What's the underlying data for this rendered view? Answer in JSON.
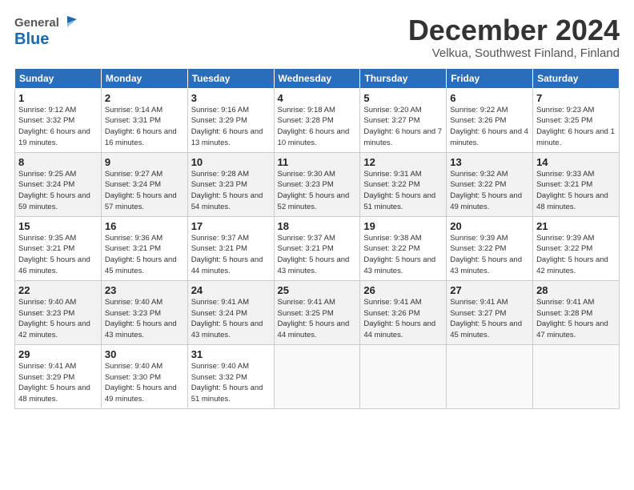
{
  "header": {
    "logo_general": "General",
    "logo_blue": "Blue",
    "month_title": "December 2024",
    "location": "Velkua, Southwest Finland, Finland"
  },
  "weekdays": [
    "Sunday",
    "Monday",
    "Tuesday",
    "Wednesday",
    "Thursday",
    "Friday",
    "Saturday"
  ],
  "weeks": [
    [
      {
        "day": 1,
        "sunrise": "9:12 AM",
        "sunset": "3:32 PM",
        "daylight": "6 hours and 19 minutes."
      },
      {
        "day": 2,
        "sunrise": "9:14 AM",
        "sunset": "3:31 PM",
        "daylight": "6 hours and 16 minutes."
      },
      {
        "day": 3,
        "sunrise": "9:16 AM",
        "sunset": "3:29 PM",
        "daylight": "6 hours and 13 minutes."
      },
      {
        "day": 4,
        "sunrise": "9:18 AM",
        "sunset": "3:28 PM",
        "daylight": "6 hours and 10 minutes."
      },
      {
        "day": 5,
        "sunrise": "9:20 AM",
        "sunset": "3:27 PM",
        "daylight": "6 hours and 7 minutes."
      },
      {
        "day": 6,
        "sunrise": "9:22 AM",
        "sunset": "3:26 PM",
        "daylight": "6 hours and 4 minutes."
      },
      {
        "day": 7,
        "sunrise": "9:23 AM",
        "sunset": "3:25 PM",
        "daylight": "6 hours and 1 minute."
      }
    ],
    [
      {
        "day": 8,
        "sunrise": "9:25 AM",
        "sunset": "3:24 PM",
        "daylight": "5 hours and 59 minutes."
      },
      {
        "day": 9,
        "sunrise": "9:27 AM",
        "sunset": "3:24 PM",
        "daylight": "5 hours and 57 minutes."
      },
      {
        "day": 10,
        "sunrise": "9:28 AM",
        "sunset": "3:23 PM",
        "daylight": "5 hours and 54 minutes."
      },
      {
        "day": 11,
        "sunrise": "9:30 AM",
        "sunset": "3:23 PM",
        "daylight": "5 hours and 52 minutes."
      },
      {
        "day": 12,
        "sunrise": "9:31 AM",
        "sunset": "3:22 PM",
        "daylight": "5 hours and 51 minutes."
      },
      {
        "day": 13,
        "sunrise": "9:32 AM",
        "sunset": "3:22 PM",
        "daylight": "5 hours and 49 minutes."
      },
      {
        "day": 14,
        "sunrise": "9:33 AM",
        "sunset": "3:21 PM",
        "daylight": "5 hours and 48 minutes."
      }
    ],
    [
      {
        "day": 15,
        "sunrise": "9:35 AM",
        "sunset": "3:21 PM",
        "daylight": "5 hours and 46 minutes."
      },
      {
        "day": 16,
        "sunrise": "9:36 AM",
        "sunset": "3:21 PM",
        "daylight": "5 hours and 45 minutes."
      },
      {
        "day": 17,
        "sunrise": "9:37 AM",
        "sunset": "3:21 PM",
        "daylight": "5 hours and 44 minutes."
      },
      {
        "day": 18,
        "sunrise": "9:37 AM",
        "sunset": "3:21 PM",
        "daylight": "5 hours and 43 minutes."
      },
      {
        "day": 19,
        "sunrise": "9:38 AM",
        "sunset": "3:22 PM",
        "daylight": "5 hours and 43 minutes."
      },
      {
        "day": 20,
        "sunrise": "9:39 AM",
        "sunset": "3:22 PM",
        "daylight": "5 hours and 43 minutes."
      },
      {
        "day": 21,
        "sunrise": "9:39 AM",
        "sunset": "3:22 PM",
        "daylight": "5 hours and 42 minutes."
      }
    ],
    [
      {
        "day": 22,
        "sunrise": "9:40 AM",
        "sunset": "3:23 PM",
        "daylight": "5 hours and 42 minutes."
      },
      {
        "day": 23,
        "sunrise": "9:40 AM",
        "sunset": "3:23 PM",
        "daylight": "5 hours and 43 minutes."
      },
      {
        "day": 24,
        "sunrise": "9:41 AM",
        "sunset": "3:24 PM",
        "daylight": "5 hours and 43 minutes."
      },
      {
        "day": 25,
        "sunrise": "9:41 AM",
        "sunset": "3:25 PM",
        "daylight": "5 hours and 44 minutes."
      },
      {
        "day": 26,
        "sunrise": "9:41 AM",
        "sunset": "3:26 PM",
        "daylight": "5 hours and 44 minutes."
      },
      {
        "day": 27,
        "sunrise": "9:41 AM",
        "sunset": "3:27 PM",
        "daylight": "5 hours and 45 minutes."
      },
      {
        "day": 28,
        "sunrise": "9:41 AM",
        "sunset": "3:28 PM",
        "daylight": "5 hours and 47 minutes."
      }
    ],
    [
      {
        "day": 29,
        "sunrise": "9:41 AM",
        "sunset": "3:29 PM",
        "daylight": "5 hours and 48 minutes."
      },
      {
        "day": 30,
        "sunrise": "9:40 AM",
        "sunset": "3:30 PM",
        "daylight": "5 hours and 49 minutes."
      },
      {
        "day": 31,
        "sunrise": "9:40 AM",
        "sunset": "3:32 PM",
        "daylight": "5 hours and 51 minutes."
      },
      null,
      null,
      null,
      null
    ]
  ]
}
